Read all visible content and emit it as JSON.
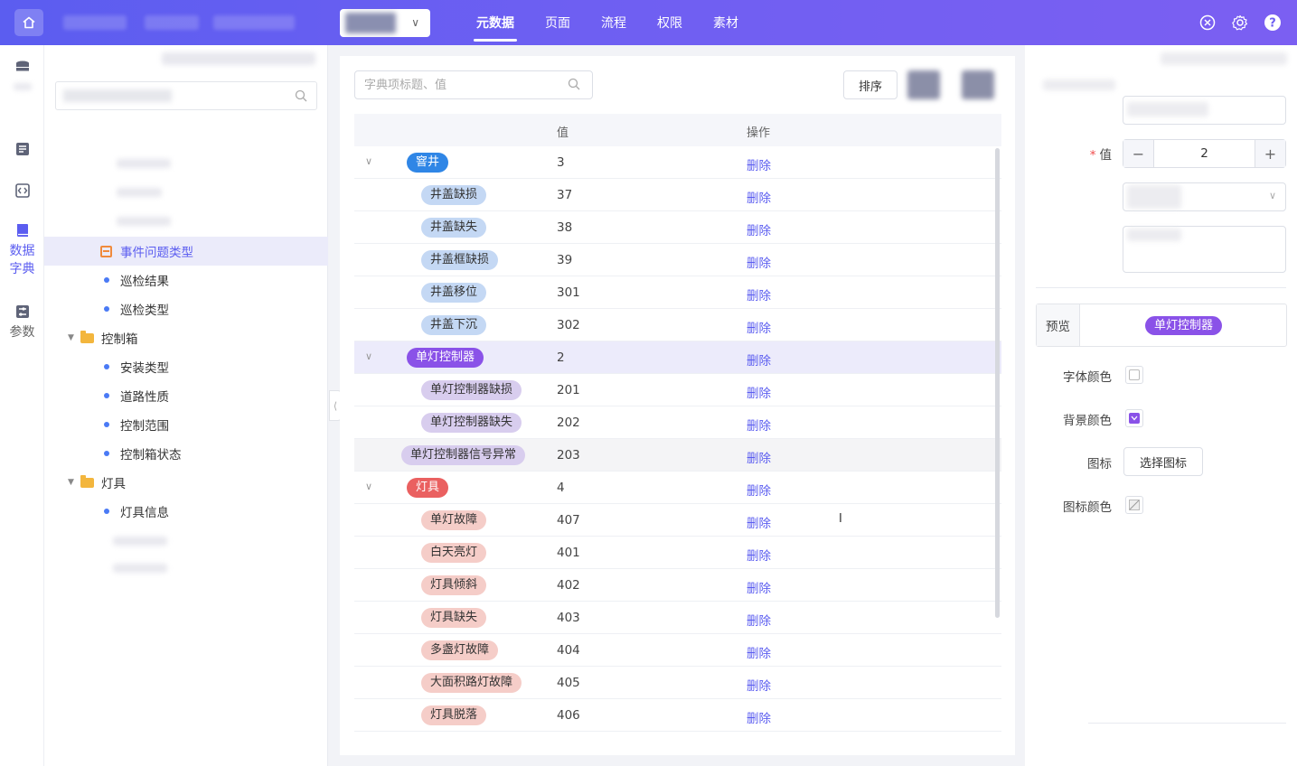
{
  "header": {
    "tabs": [
      {
        "label": "元数据",
        "active": true
      },
      {
        "label": "页面",
        "active": false
      },
      {
        "label": "流程",
        "active": false
      },
      {
        "label": "权限",
        "active": false
      },
      {
        "label": "素材",
        "active": false
      }
    ],
    "accent_color": "#5b5df0"
  },
  "rail": {
    "items": [
      {
        "label": "",
        "icon": "database-icon"
      },
      {
        "label": "",
        "icon": "form-icon"
      },
      {
        "label": "",
        "icon": "code-icon"
      },
      {
        "label": "数据字典",
        "icon": "book-icon",
        "active": true
      },
      {
        "label": "参数",
        "icon": "param-icon"
      }
    ]
  },
  "tree": {
    "items": [
      {
        "label": "事件问题类型",
        "type": "doc",
        "selected": true
      },
      {
        "label": "巡检结果",
        "type": "leaf"
      },
      {
        "label": "巡检类型",
        "type": "leaf"
      },
      {
        "label": "控制箱",
        "type": "folder"
      },
      {
        "label": "安装类型",
        "type": "leaf"
      },
      {
        "label": "道路性质",
        "type": "leaf"
      },
      {
        "label": "控制范围",
        "type": "leaf"
      },
      {
        "label": "控制箱状态",
        "type": "leaf"
      },
      {
        "label": "灯具",
        "type": "folder"
      },
      {
        "label": "灯具信息",
        "type": "leaf"
      }
    ]
  },
  "main": {
    "search_placeholder": "字典项标题、值",
    "sort_label": "排序",
    "columns": {
      "value": "值",
      "action": "操作"
    },
    "delete_label": "删除",
    "rows": [
      {
        "label": "窨井",
        "value": "3",
        "level": "parent",
        "color": "blue"
      },
      {
        "label": "井盖缺损",
        "value": "37",
        "level": "child",
        "color": "blue"
      },
      {
        "label": "井盖缺失",
        "value": "38",
        "level": "child",
        "color": "blue"
      },
      {
        "label": "井盖框缺损",
        "value": "39",
        "level": "child",
        "color": "blue"
      },
      {
        "label": "井盖移位",
        "value": "301",
        "level": "child",
        "color": "blue"
      },
      {
        "label": "井盖下沉",
        "value": "302",
        "level": "child",
        "color": "blue"
      },
      {
        "label": "单灯控制器",
        "value": "2",
        "level": "parent",
        "color": "purple",
        "highlighted": true
      },
      {
        "label": "单灯控制器缺损",
        "value": "201",
        "level": "child",
        "color": "purple"
      },
      {
        "label": "单灯控制器缺失",
        "value": "202",
        "level": "child",
        "color": "purple"
      },
      {
        "label": "单灯控制器信号异常",
        "value": "203",
        "level": "floating",
        "color": "purple",
        "hover": true
      },
      {
        "label": "灯具",
        "value": "4",
        "level": "parent",
        "color": "red"
      },
      {
        "label": "单灯故障",
        "value": "407",
        "level": "child",
        "color": "red"
      },
      {
        "label": "白天亮灯",
        "value": "401",
        "level": "child",
        "color": "red"
      },
      {
        "label": "灯具倾斜",
        "value": "402",
        "level": "child",
        "color": "red"
      },
      {
        "label": "灯具缺失",
        "value": "403",
        "level": "child",
        "color": "red"
      },
      {
        "label": "多盏灯故障",
        "value": "404",
        "level": "child",
        "color": "red"
      },
      {
        "label": "大面积路灯故障",
        "value": "405",
        "level": "child",
        "color": "red"
      },
      {
        "label": "灯具脱落",
        "value": "406",
        "level": "child",
        "color": "red"
      }
    ]
  },
  "detail": {
    "value_label": "值",
    "value": "2",
    "preview_label": "预览",
    "preview_text": "单灯控制器",
    "font_color_label": "字体颜色",
    "bg_color_label": "背景颜色",
    "bg_color": "#8a52e8",
    "icon_label": "图标",
    "choose_icon_label": "选择图标",
    "icon_color_label": "图标颜色"
  }
}
